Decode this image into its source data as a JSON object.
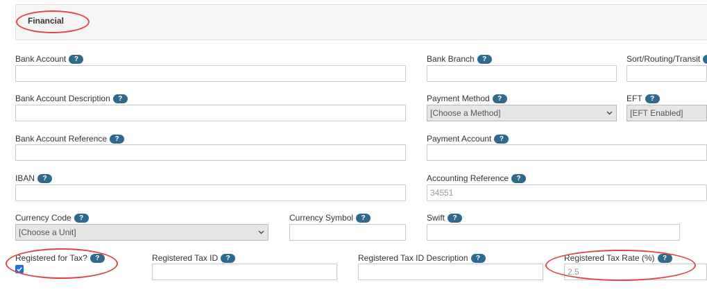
{
  "section": {
    "title": "Financial"
  },
  "help_label": "?",
  "fields": {
    "bank_account": {
      "label": "Bank Account",
      "value": ""
    },
    "bank_branch": {
      "label": "Bank Branch",
      "value": ""
    },
    "sort_routing": {
      "label": "Sort/Routing/Transit",
      "value": ""
    },
    "bank_account_description": {
      "label": "Bank Account Description",
      "value": ""
    },
    "payment_method": {
      "label": "Payment Method",
      "selected": "[Choose a Method]"
    },
    "eft": {
      "label": "EFT",
      "selected": "[EFT Enabled]"
    },
    "bank_account_reference": {
      "label": "Bank Account Reference",
      "value": ""
    },
    "payment_account": {
      "label": "Payment Account",
      "value": ""
    },
    "iban": {
      "label": "IBAN",
      "value": ""
    },
    "accounting_reference": {
      "label": "Accounting Reference",
      "value": "34551"
    },
    "currency_code": {
      "label": "Currency Code",
      "selected": "[Choose a Unit]"
    },
    "currency_symbol": {
      "label": "Currency Symbol",
      "value": ""
    },
    "swift": {
      "label": "Swift",
      "value": ""
    },
    "registered_for_tax": {
      "label": "Registered for Tax?",
      "checked": true
    },
    "registered_tax_id": {
      "label": "Registered Tax ID",
      "value": ""
    },
    "registered_tax_id_description": {
      "label": "Registered Tax ID Description",
      "value": ""
    },
    "registered_tax_rate": {
      "label": "Registered Tax Rate (%)",
      "value": "2.5"
    }
  },
  "colors": {
    "accent": "#2e6a8e",
    "annotation": "#e04444",
    "checkbox": "#1a73e8"
  }
}
